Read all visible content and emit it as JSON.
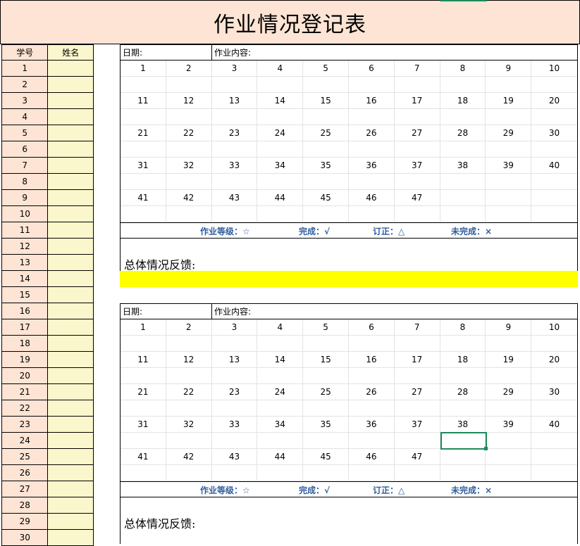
{
  "title": "作业情况登记表",
  "roster": {
    "header_number": "学号",
    "header_name": "姓名",
    "numbers": [
      "1",
      "2",
      "3",
      "4",
      "5",
      "6",
      "7",
      "8",
      "9",
      "10",
      "11",
      "12",
      "13",
      "14",
      "15",
      "16",
      "17",
      "18",
      "19",
      "20",
      "21",
      "22",
      "23",
      "24",
      "25",
      "26",
      "27",
      "28",
      "29",
      "30"
    ]
  },
  "blocks": [
    {
      "date_label": "日期:",
      "content_label": "作业内容:",
      "number_rows": [
        [
          "1",
          "2",
          "3",
          "4",
          "5",
          "6",
          "7",
          "8",
          "9",
          "10"
        ],
        [
          "11",
          "12",
          "13",
          "14",
          "15",
          "16",
          "17",
          "18",
          "19",
          "20"
        ],
        [
          "21",
          "22",
          "23",
          "24",
          "25",
          "26",
          "27",
          "28",
          "29",
          "30"
        ],
        [
          "31",
          "32",
          "33",
          "34",
          "35",
          "36",
          "37",
          "38",
          "39",
          "40"
        ],
        [
          "41",
          "42",
          "43",
          "44",
          "45",
          "46",
          "47",
          "",
          "",
          ""
        ]
      ],
      "legend": [
        "作业等级：☆",
        "完成：√",
        "订正：△",
        "未完成：×"
      ],
      "feedback_label": "总体情况反馈:"
    },
    {
      "date_label": "日期:",
      "content_label": "作业内容:",
      "number_rows": [
        [
          "1",
          "2",
          "3",
          "4",
          "5",
          "6",
          "7",
          "8",
          "9",
          "10"
        ],
        [
          "11",
          "12",
          "13",
          "14",
          "15",
          "16",
          "17",
          "18",
          "19",
          "20"
        ],
        [
          "21",
          "22",
          "23",
          "24",
          "25",
          "26",
          "27",
          "28",
          "29",
          "30"
        ],
        [
          "31",
          "32",
          "33",
          "34",
          "35",
          "36",
          "37",
          "38",
          "39",
          "40"
        ],
        [
          "41",
          "42",
          "43",
          "44",
          "45",
          "46",
          "47",
          "",
          "",
          ""
        ]
      ],
      "legend": [
        "作业等级：☆",
        "完成：√",
        "订正：△",
        "未完成：×"
      ],
      "feedback_label": "总体情况反馈:"
    }
  ],
  "colors": {
    "header_fill": "#fde4d4",
    "name_fill": "#fbf7cc",
    "separator_yellow": "#ffff00",
    "legend_text": "#2f5d9b",
    "selection": "#1e8a5a"
  }
}
